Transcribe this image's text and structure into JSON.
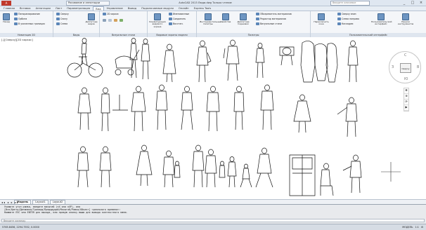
{
  "app": {
    "title": "AutoCAD 2013   Люди.dwg   Только чтение",
    "document_tab": "Рисование и аннотации",
    "search_placeholder": "Введите ключевое",
    "window_buttons": [
      "_",
      "□",
      "×"
    ]
  },
  "ribbon_tabs": [
    "Главная",
    "Вставка",
    "Аннотации",
    "Лист",
    "Параметризация",
    "Вид",
    "Управление",
    "Вывод",
    "Подключаемые модули",
    "Онлайн",
    "Express Tools"
  ],
  "active_tab": "Вид",
  "ribbon": {
    "panels": [
      {
        "title": "Навигация 2D",
        "buttons": [
          "Назад",
          "Панорамирование",
          "Орбита",
          "В указанных границах"
        ]
      },
      {
        "title": "Виды",
        "buttons": [
          "Сверху",
          "Снизу",
          "Слева",
          "Диспетчер видов"
        ]
      },
      {
        "title": "Визуальные стили",
        "buttons": [
          "2D каркас",
          "Визуальные стили"
        ]
      },
      {
        "title": "Видовые экраны модели",
        "buttons": [
          "Конфигурация видового экрана",
          "Именованные",
          "Соединить",
          "Восстан."
        ]
      },
      {
        "title": "Палитры",
        "buttons": [
          "Инструментальные палитры",
          "Свойства",
          "Диспетчер подшивок",
          "Обозреватель материалов",
          "Редактор материалов",
          "Визуальные стили"
        ]
      },
      {
        "title": "Пользовательский интерфейс",
        "buttons": [
          "Переключить окна",
          "Сверху вниз",
          "Слева направо",
          "Каскадом",
          "Пользовательский интерфейс",
          "Панели инструментов"
        ]
      }
    ]
  },
  "viewport": {
    "label": "[-][Сверху][2D каркас]",
    "viewcube": {
      "face": "Сверху",
      "directions": [
        "С",
        "З",
        "В",
        "Ю"
      ]
    },
    "nav_icons": [
      "pan-icon",
      "zoom-icon",
      "orbit-icon",
      "showmotion-icon"
    ]
  },
  "layout_tabs": [
    "Модель",
    "Layout1",
    "Layout2"
  ],
  "active_layout": "Модель",
  "command_lines": [
    "Укажите угол рамки, введите масштаб (nX или nXP), или",
    "[Все/Центр/Динамика/Границы/Предыдущий/Масштаб/Рамка/Объект] <реального времени>:",
    "Нажмите ESC или ENTER для выхода, или правую кнопку мыши для вывода контекстного меню."
  ],
  "command_prompt": "Введите команду",
  "status": {
    "coords": "5765.8456, 2294.7552, 0.0000",
    "toggles": [
      "МОДЕЛЬ",
      "1:1",
      "⚙"
    ]
  },
  "colors": {
    "accent": "#5b86b8",
    "app_button": "#c0392b",
    "ribbon_bg": "#f4f6f9"
  }
}
